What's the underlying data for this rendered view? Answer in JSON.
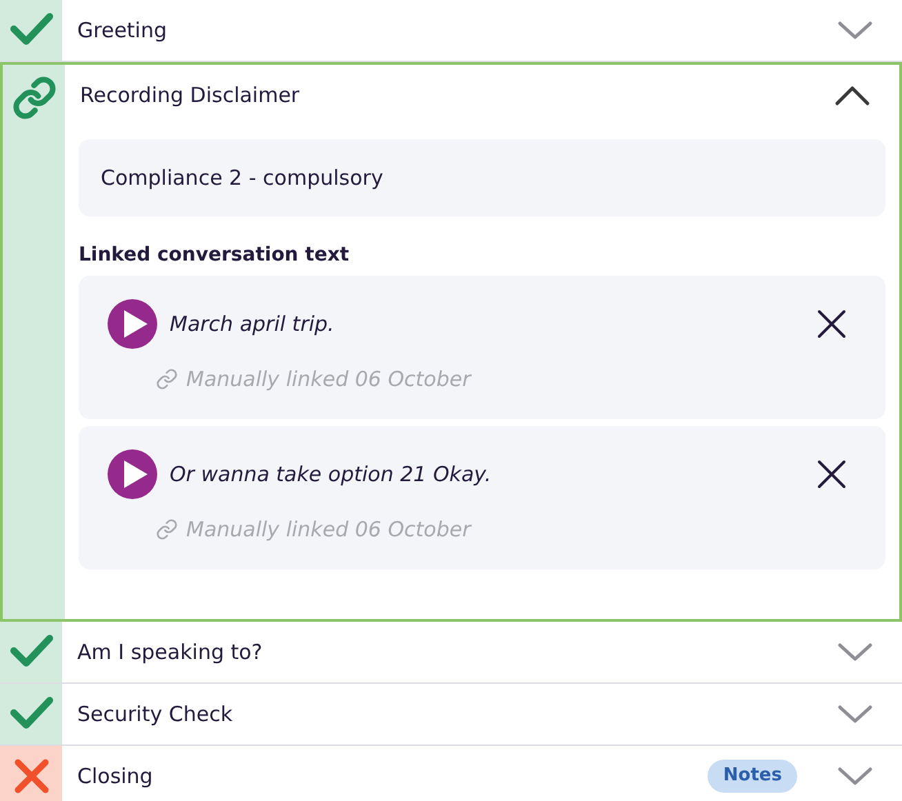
{
  "sections": [
    {
      "title": "Greeting",
      "kind": "done",
      "expanded": false
    },
    {
      "title": "Recording Disclaimer",
      "kind": "linked",
      "expanded": true,
      "compliance": "Compliance 2 - compulsory",
      "linked_heading": "Linked conversation text",
      "linked": [
        {
          "text": "March april trip.",
          "meta": "Manually linked 06 October"
        },
        {
          "text": "Or wanna take option 21 Okay.",
          "meta": "Manually linked 06 October"
        }
      ]
    },
    {
      "title": "Am I speaking to?",
      "kind": "done",
      "expanded": false
    },
    {
      "title": "Security Check",
      "kind": "done",
      "expanded": false
    },
    {
      "title": "Closing",
      "kind": "failed",
      "expanded": false,
      "badge": "Notes"
    }
  ]
}
